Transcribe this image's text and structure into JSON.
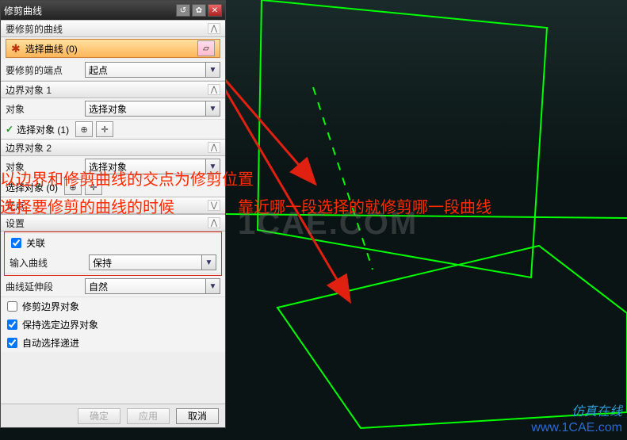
{
  "title": "修剪曲线",
  "sections": {
    "toTrim": {
      "header": "要修剪的曲线",
      "selectCurve": "选择曲线 (0)",
      "endpoint_label": "要修剪的端点",
      "endpoint_value": "起点"
    },
    "boundary1": {
      "header": "边界对象 1",
      "obj_label": "对象",
      "obj_value": "选择对象",
      "selectObj": "选择对象 (1)"
    },
    "boundary2": {
      "header": "边界对象 2",
      "obj_label": "对象",
      "obj_value": "选择对象",
      "selectObj": "选择对象 (0)"
    },
    "intersection": {
      "header": "交点"
    },
    "settings": {
      "header": "设置",
      "associate": "关联",
      "input_label": "输入曲线",
      "input_value": "保持",
      "extend_label": "曲线延伸段",
      "extend_value": "自然",
      "trimBoundary": "修剪边界对象",
      "keepBoundary": "保持选定边界对象",
      "autoSelect": "自动选择递进"
    }
  },
  "buttons": {
    "ok": "确定",
    "apply": "应用",
    "cancel": "取消"
  },
  "overlay": {
    "line1": "以边界和修剪曲线的交点为修剪位置",
    "line2a": "选择要修剪的曲线的时候",
    "line2b": "靠近哪一段选择的就修剪哪一段曲线"
  },
  "watermarks": {
    "center": "1CAE.COM",
    "url": "www.1CAE.com",
    "slogan": "仿真在线"
  }
}
